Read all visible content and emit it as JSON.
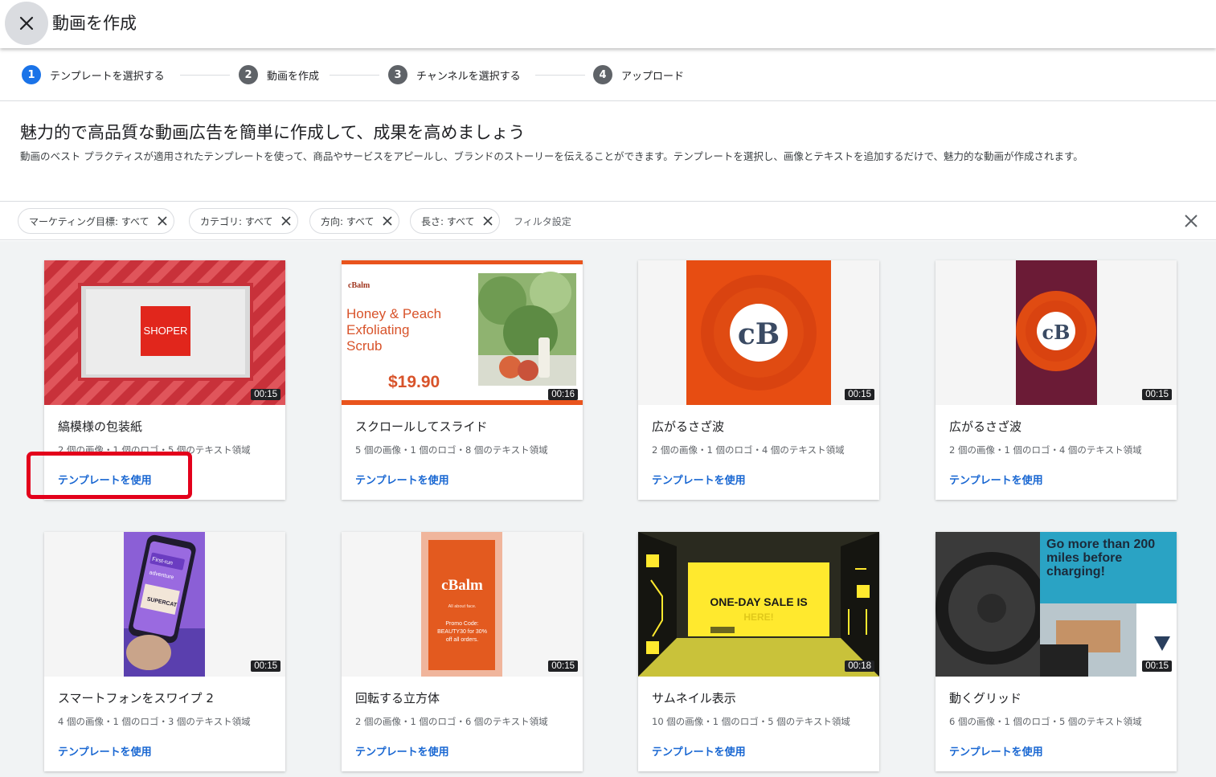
{
  "header": {
    "title": "動画を作成",
    "close_icon": "close-icon"
  },
  "stepper": {
    "steps": [
      {
        "number": "1",
        "label": "テンプレートを選択する",
        "active": true
      },
      {
        "number": "2",
        "label": "動画を作成",
        "active": false
      },
      {
        "number": "3",
        "label": "チャンネルを選択する",
        "active": false
      },
      {
        "number": "4",
        "label": "アップロード",
        "active": false
      }
    ]
  },
  "intro": {
    "title": "魅力的で高品質な動画広告を簡単に作成して、成果を高めましょう",
    "description": "動画のベスト プラクティスが適用されたテンプレートを使って、商品やサービスをアピールし、ブランドのストーリーを伝えることができます。テンプレートを選択し、画像とテキストを追加するだけで、魅力的な動画が作成されます。"
  },
  "filters": {
    "chips": [
      {
        "label": "マーケティング目標: すべて"
      },
      {
        "label": "カテゴリ: すべて"
      },
      {
        "label": "方向: すべて"
      },
      {
        "label": "長さ: すべて"
      }
    ],
    "settings_label": "フィルタ設定",
    "clear_icon": "close-icon"
  },
  "cards": [
    {
      "title": "縞模様の包装紙",
      "meta": "2 個の画像・1 個のロゴ・5 個のテキスト領域",
      "duration": "00:15",
      "action": "テンプレートを使用",
      "thumb_text": "SHOPER"
    },
    {
      "title": "スクロールしてスライド",
      "meta": "5 個の画像・1 個のロゴ・8 個のテキスト領域",
      "duration": "00:16",
      "action": "テンプレートを使用",
      "thumb_brand": "cBalm",
      "thumb_product": "Honey & Peach Exfoliating Scrub",
      "thumb_price": "$19.90"
    },
    {
      "title": "広がるさざ波",
      "meta": "2 個の画像・1 個のロゴ・4 個のテキスト領域",
      "duration": "00:15",
      "action": "テンプレートを使用",
      "thumb_logo": "cB"
    },
    {
      "title": "広がるさざ波",
      "meta": "2 個の画像・1 個のロゴ・4 個のテキスト領域",
      "duration": "00:15",
      "action": "テンプレートを使用",
      "thumb_logo": "cB"
    },
    {
      "title": "スマートフォンをスワイプ 2",
      "meta": "4 個の画像・1 個のロゴ・3 個のテキスト領域",
      "duration": "00:15",
      "action": "テンプレートを使用",
      "thumb_text": "First-run adventure",
      "thumb_sub": "SUPERCAT"
    },
    {
      "title": "回転する立方体",
      "meta": "2 個の画像・1 個のロゴ・6 個のテキスト領域",
      "duration": "00:15",
      "action": "テンプレートを使用",
      "thumb_brand": "cBalm",
      "thumb_tagline": "All about face.",
      "thumb_promo": "Promo Code: BEAUTY30 for 30% off all orders."
    },
    {
      "title": "サムネイル表示",
      "meta": "10 個の画像・1 個のロゴ・5 個のテキスト領域",
      "duration": "00:18",
      "action": "テンプレートを使用",
      "thumb_text": "ONE-DAY SALE IS",
      "thumb_sub": "HERE!"
    },
    {
      "title": "動くグリッド",
      "meta": "6 個の画像・1 個のロゴ・5 個のテキスト領域",
      "duration": "00:15",
      "action": "テンプレートを使用",
      "thumb_text": "Go more than 200 miles before charging!"
    }
  ],
  "colors": {
    "accent": "#1a73e8",
    "link": "#1967d2",
    "highlight": "#e3001b"
  }
}
